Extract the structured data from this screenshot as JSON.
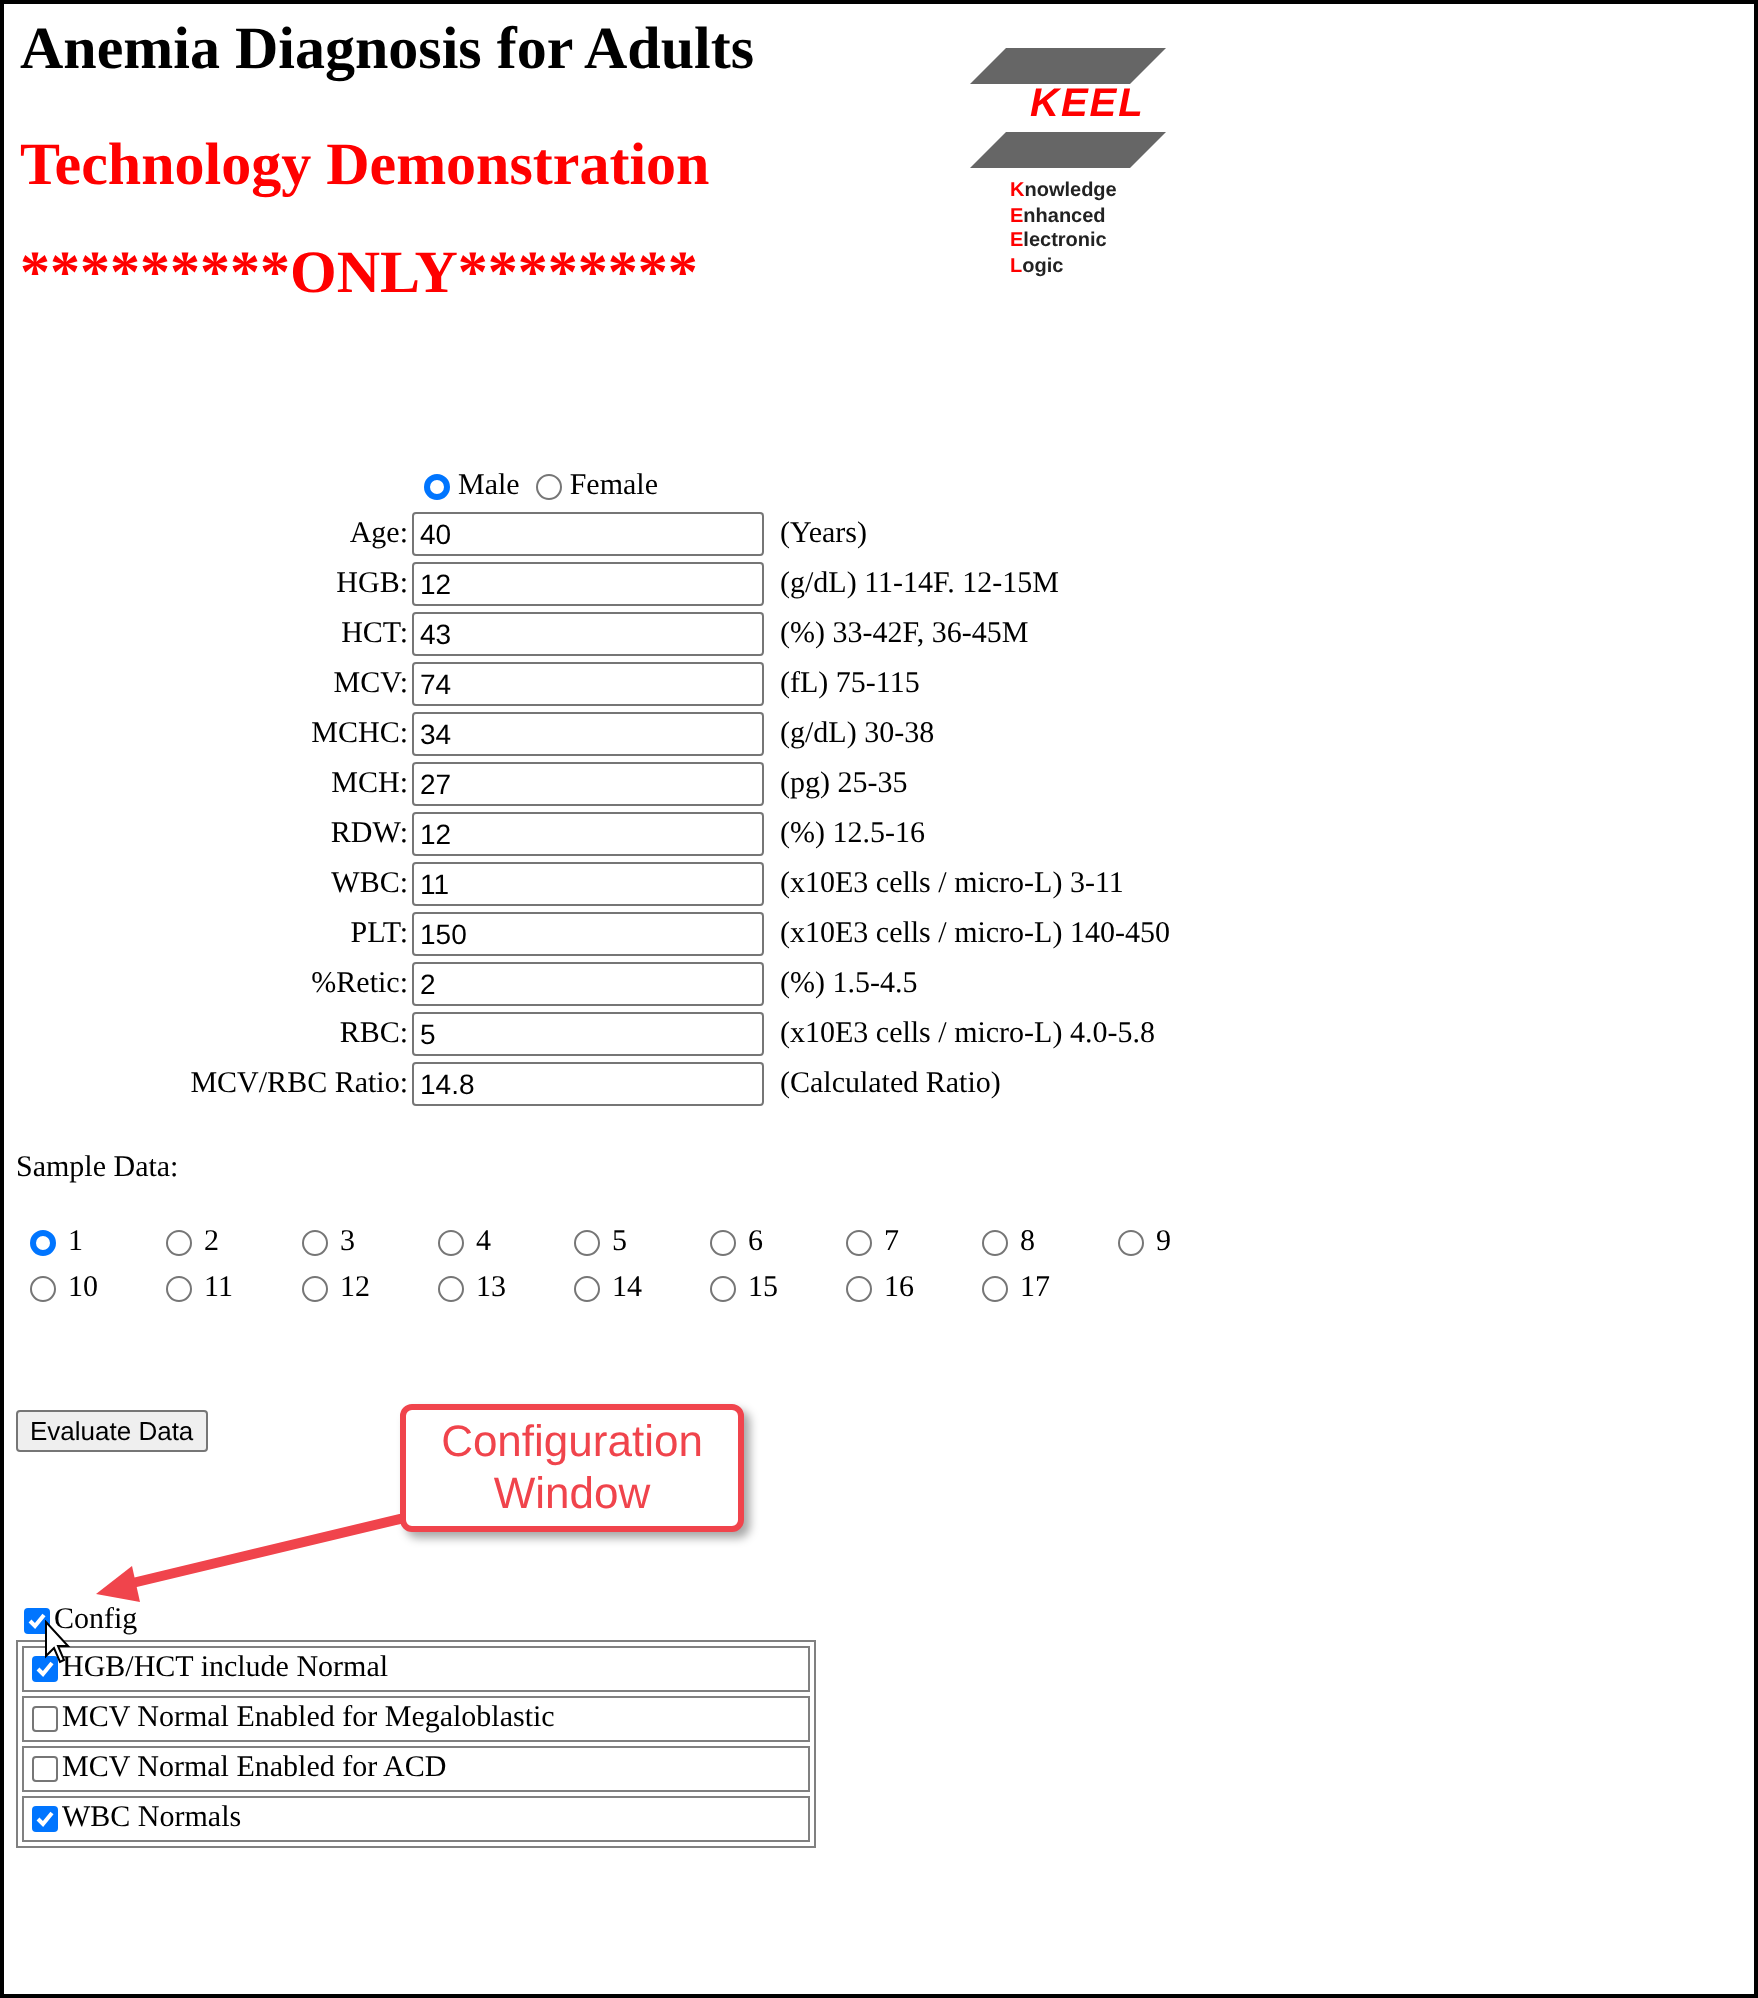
{
  "header": {
    "title": "Anemia Diagnosis for Adults",
    "subtitle": "Technology Demonstration",
    "notice": "*********ONLY********"
  },
  "logo": {
    "wordmark": "KEEL",
    "words": [
      "Knowledge",
      "Enhanced",
      "Electronic",
      "Logic"
    ]
  },
  "sex": [
    {
      "label": "Male",
      "selected": true
    },
    {
      "label": "Female",
      "selected": false
    }
  ],
  "fields": [
    {
      "label": "Age:",
      "value": "40",
      "note": "(Years)"
    },
    {
      "label": "HGB:",
      "value": "12",
      "note": "(g/dL) 11-14F. 12-15M"
    },
    {
      "label": "HCT:",
      "value": "43",
      "note": "(%) 33-42F, 36-45M"
    },
    {
      "label": "MCV:",
      "value": "74",
      "note": "(fL) 75-115"
    },
    {
      "label": "MCHC:",
      "value": "34",
      "note": "(g/dL) 30-38"
    },
    {
      "label": "MCH:",
      "value": "27",
      "note": "(pg) 25-35"
    },
    {
      "label": "RDW:",
      "value": "12",
      "note": "(%) 12.5-16"
    },
    {
      "label": "WBC:",
      "value": "11",
      "note": "(x10E3 cells / micro-L) 3-11"
    },
    {
      "label": "PLT:",
      "value": "150",
      "note": "(x10E3 cells / micro-L) 140-450"
    },
    {
      "label": "%Retic:",
      "value": "2",
      "note": "(%) 1.5-4.5"
    },
    {
      "label": "RBC:",
      "value": "5",
      "note": "(x10E3 cells / micro-L) 4.0-5.8"
    },
    {
      "label": "MCV/RBC Ratio:",
      "value": "14.8",
      "note": "(Calculated Ratio)"
    }
  ],
  "sample_data": {
    "label": "Sample Data:",
    "options": [
      {
        "label": "1",
        "selected": true
      },
      {
        "label": "2",
        "selected": false
      },
      {
        "label": "3",
        "selected": false
      },
      {
        "label": "4",
        "selected": false
      },
      {
        "label": "5",
        "selected": false
      },
      {
        "label": "6",
        "selected": false
      },
      {
        "label": "7",
        "selected": false
      },
      {
        "label": "8",
        "selected": false
      },
      {
        "label": "9",
        "selected": false
      },
      {
        "label": "10",
        "selected": false
      },
      {
        "label": "11",
        "selected": false
      },
      {
        "label": "12",
        "selected": false
      },
      {
        "label": "13",
        "selected": false
      },
      {
        "label": "14",
        "selected": false
      },
      {
        "label": "15",
        "selected": false
      },
      {
        "label": "16",
        "selected": false
      },
      {
        "label": "17",
        "selected": false
      }
    ]
  },
  "evaluate_button": "Evaluate Data",
  "callout": "Configuration Window",
  "config": {
    "label": "Config",
    "checked": true,
    "options": [
      {
        "label": "HGB/HCT include Normal",
        "checked": true
      },
      {
        "label": "MCV Normal Enabled for Megaloblastic",
        "checked": false
      },
      {
        "label": "MCV Normal Enabled for ACD",
        "checked": false
      },
      {
        "label": "WBC Normals",
        "checked": true
      }
    ]
  }
}
